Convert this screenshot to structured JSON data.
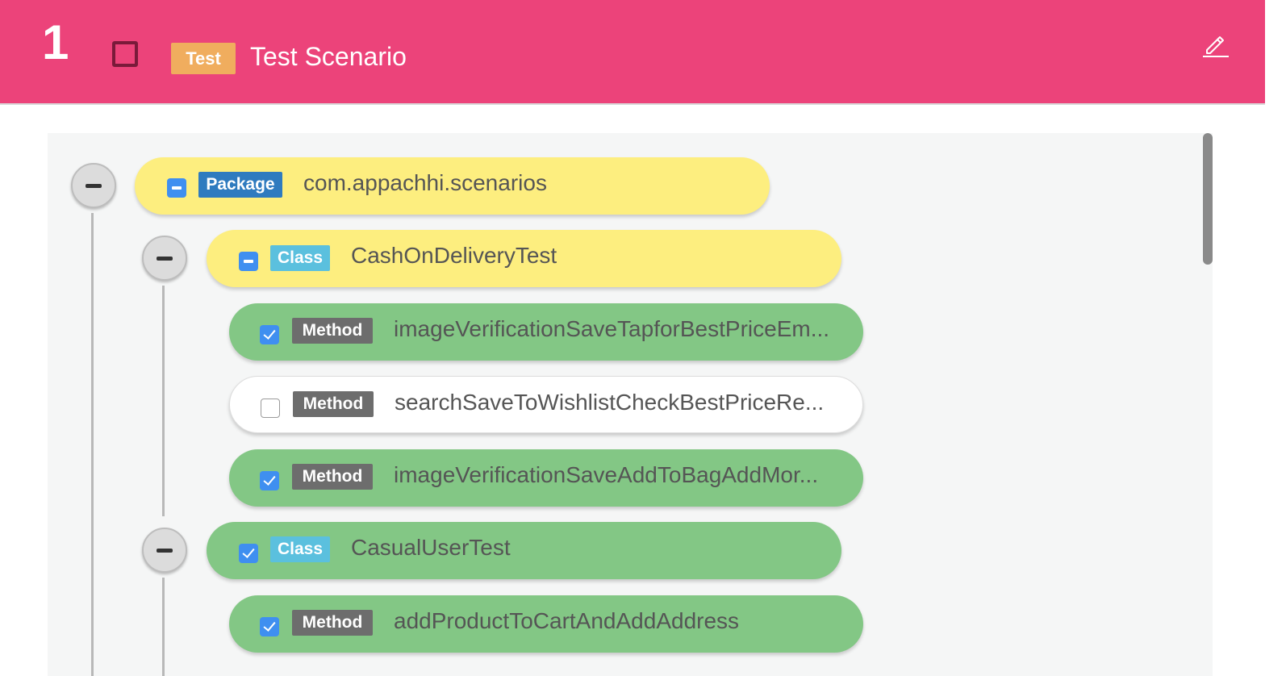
{
  "header": {
    "number": "1",
    "badge": "Test",
    "title": "Test Scenario",
    "background_color": "#ec437a",
    "edit_icon": "pencil-icon"
  },
  "tree": {
    "package": {
      "badge": "Package",
      "name": "com.appachhi.scenarios",
      "checkbox_state": "indeterminate"
    },
    "classes": [
      {
        "badge": "Class",
        "name": "CashOnDeliveryTest",
        "checkbox_state": "indeterminate",
        "methods": [
          {
            "badge": "Method",
            "name": "imageVerificationSaveTapforBestPriceEm...",
            "checked": true
          },
          {
            "badge": "Method",
            "name": "searchSaveToWishlistCheckBestPriceRe...",
            "checked": false
          },
          {
            "badge": "Method",
            "name": "imageVerificationSaveAddToBagAddMor...",
            "checked": true
          }
        ]
      },
      {
        "badge": "Class",
        "name": "CasualUserTest",
        "checkbox_state": "checked",
        "methods": [
          {
            "badge": "Method",
            "name": "addProductToCartAndAddAddress",
            "checked": true
          }
        ]
      }
    ]
  },
  "colors": {
    "partial": "#fdee7f",
    "selected": "#83c785",
    "unselected": "#ffffff",
    "package_badge": "#2f7bbf",
    "class_badge": "#5bc0de",
    "method_badge": "#6d6d6d",
    "checkbox": "#3f8ff0",
    "test_badge": "#f0ad5e"
  }
}
